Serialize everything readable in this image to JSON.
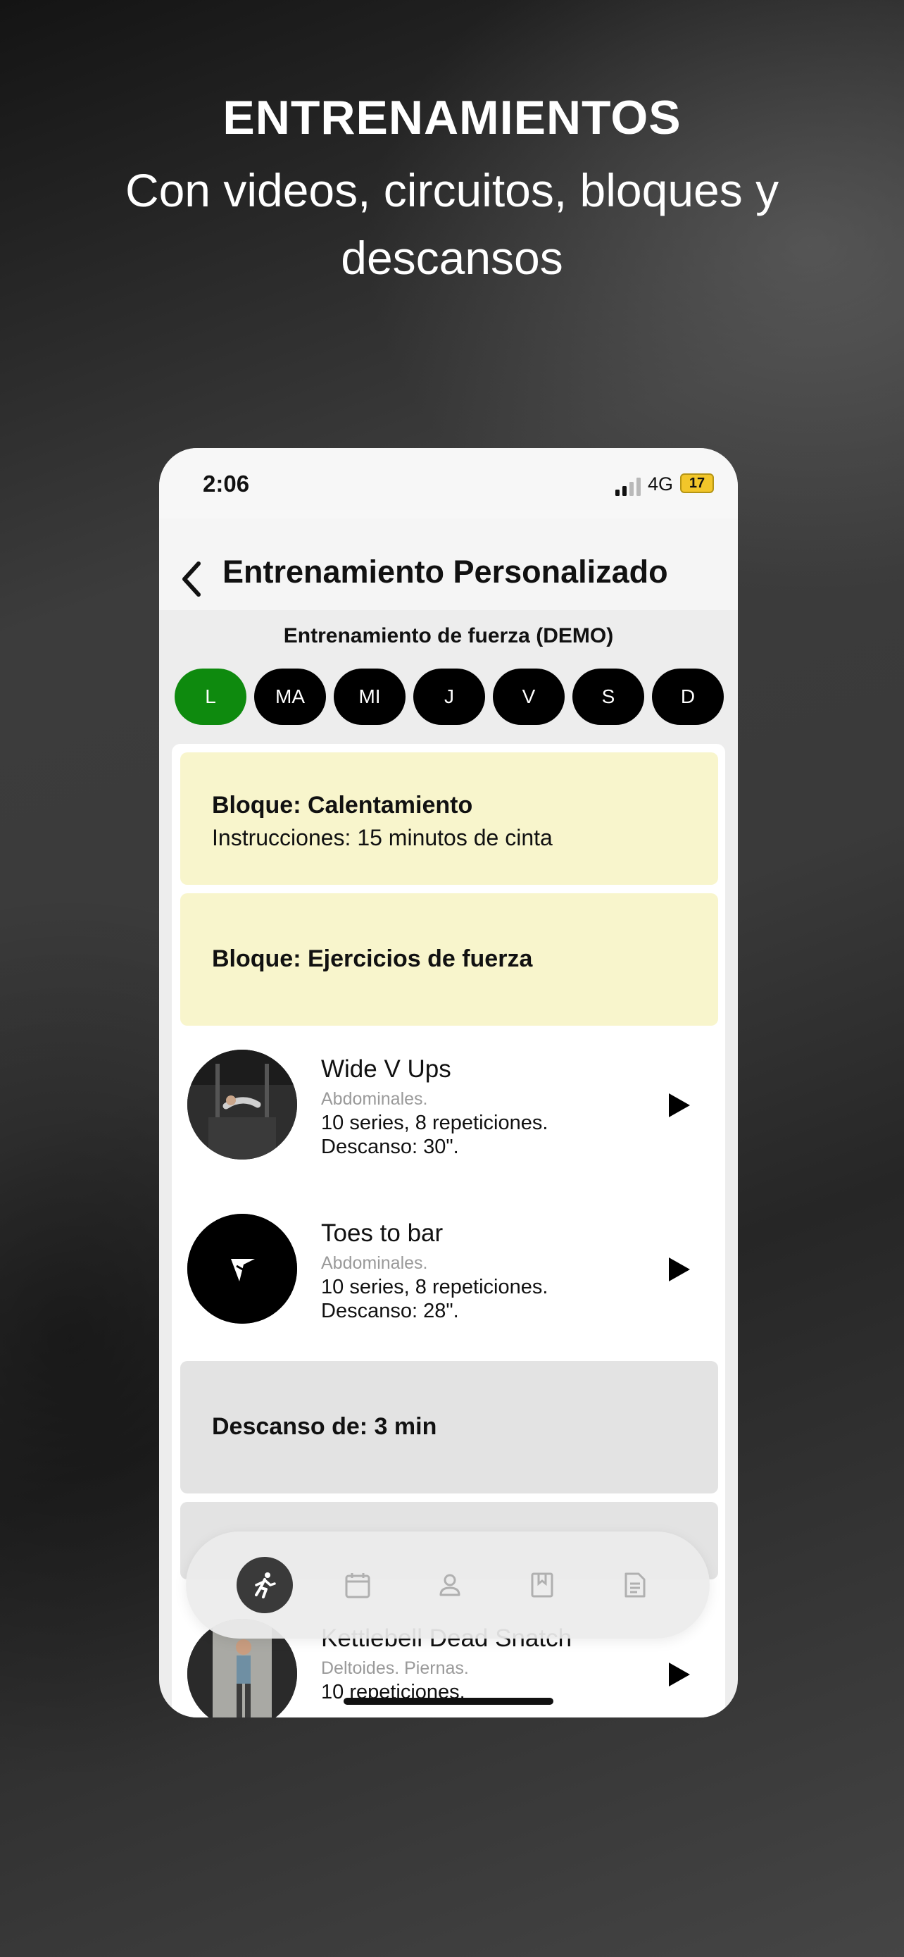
{
  "promo": {
    "title": "ENTRENAMIENTOS",
    "subtitle": "Con videos, circuitos, bloques y descansos"
  },
  "status_bar": {
    "time": "2:06",
    "network": "4G",
    "battery": "17"
  },
  "header": {
    "back_icon": "chevron-left-icon",
    "title": "Entrenamiento Personalizado"
  },
  "plan": {
    "name": "Entrenamiento de fuerza (DEMO)",
    "days": [
      "L",
      "MA",
      "MI",
      "J",
      "V",
      "S",
      "D"
    ],
    "selected_day": "L"
  },
  "blocks": [
    {
      "title": "Bloque: Calentamiento",
      "instructions": "Instrucciones: 15 minutos de cinta",
      "color": "#f8f5cc"
    },
    {
      "title": "Bloque: Ejercicios de fuerza",
      "color": "#f8f5cc"
    }
  ],
  "exercises": [
    {
      "name": "Wide V Ups",
      "muscles": "Abdominales.",
      "reps": "10 series, 8 repeticiones.",
      "rest": "Descanso: 30\"."
    },
    {
      "name": "Toes to bar",
      "muscles": "Abdominales.",
      "reps": "10 series, 8 repeticiones.",
      "rest": "Descanso: 28\"."
    },
    {
      "name": "Kettlebell Dead Snatch",
      "muscles": "Deltoides. Piernas.",
      "reps": "10 repeticiones."
    }
  ],
  "rest_block": {
    "title": "Descanso de: 3 min",
    "color": "#e3e3e3"
  },
  "tabbar": {
    "items": [
      "running-icon",
      "calendar-icon",
      "person-icon",
      "bookmark-icon",
      "document-icon"
    ],
    "active": "running-icon"
  },
  "colors": {
    "active_day": "#0e8a0e",
    "day_pill": "#000000",
    "block_yellow": "#f8f5cc",
    "block_gray": "#e3e3e3"
  }
}
